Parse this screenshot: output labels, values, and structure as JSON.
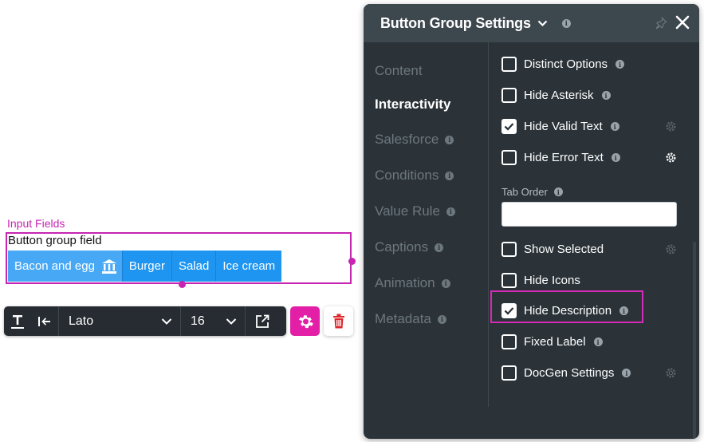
{
  "canvas": {
    "section_label": "Input Fields",
    "field_title": "Button group field",
    "buttons": [
      "Bacon and egg",
      "Burger",
      "Salad",
      "Ice cream"
    ]
  },
  "toolbar": {
    "font": "Lato",
    "size": "16"
  },
  "panel": {
    "title": "Button Group Settings",
    "nav": [
      {
        "label": "Content",
        "active": false,
        "info": false
      },
      {
        "label": "Interactivity",
        "active": true,
        "info": false
      },
      {
        "label": "Salesforce",
        "active": false,
        "info": true
      },
      {
        "label": "Conditions",
        "active": false,
        "info": true
      },
      {
        "label": "Value Rule",
        "active": false,
        "info": true
      },
      {
        "label": "Captions",
        "active": false,
        "info": true
      },
      {
        "label": "Animation",
        "active": false,
        "info": true
      },
      {
        "label": "Metadata",
        "active": false,
        "info": true
      }
    ],
    "options": [
      {
        "label": "Distinct Options",
        "checked": false
      },
      {
        "label": "Hide Asterisk",
        "checked": false
      },
      {
        "label": "Hide Valid Text",
        "checked": true
      },
      {
        "label": "Hide Error Text",
        "checked": false
      },
      {
        "label": "Show Selected",
        "checked": false
      },
      {
        "label": "Hide Icons",
        "checked": false
      },
      {
        "label": "Hide Description",
        "checked": true
      },
      {
        "label": "Fixed Label",
        "checked": false
      },
      {
        "label": "DocGen Settings",
        "checked": false
      }
    ],
    "tab_order_label": "Tab Order",
    "tab_order_value": ""
  },
  "colors": {
    "accent": "#c724b1",
    "panel_bg": "#2b3339",
    "button_blue": "#1e95f0"
  }
}
